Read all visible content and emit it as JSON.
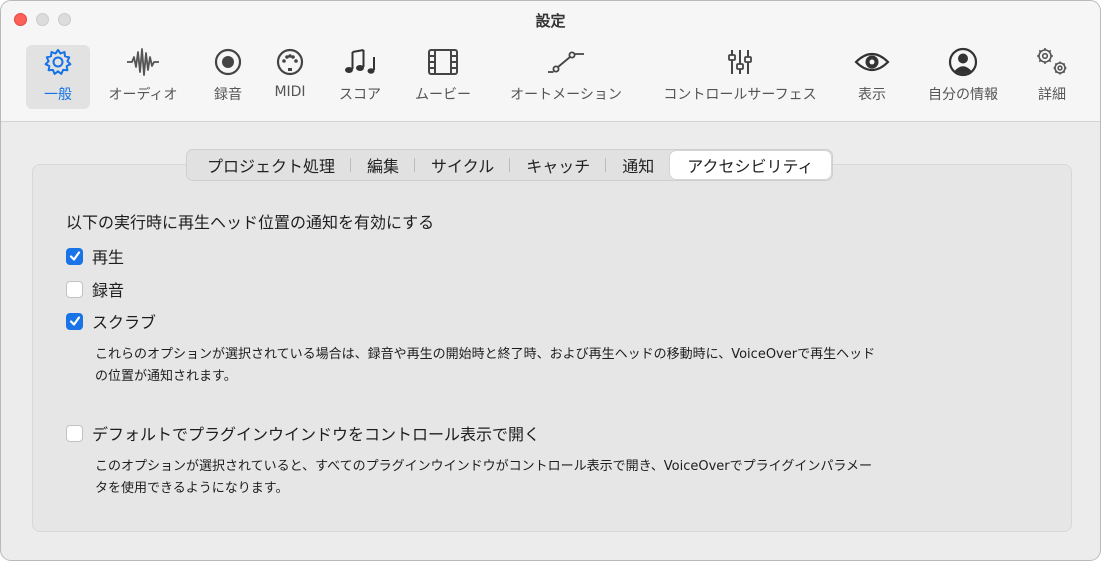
{
  "window": {
    "title": "設定"
  },
  "toolbar": {
    "items": [
      {
        "label": "一般",
        "icon": "gear-icon",
        "active": true
      },
      {
        "label": "オーディオ",
        "icon": "waveform-icon"
      },
      {
        "label": "録音",
        "icon": "record-icon"
      },
      {
        "label": "MIDI",
        "icon": "midi-port-icon"
      },
      {
        "label": "スコア",
        "icon": "music-notes-icon"
      },
      {
        "label": "ムービー",
        "icon": "film-icon"
      },
      {
        "label": "オートメーション",
        "icon": "automation-curve-icon"
      },
      {
        "label": "コントロールサーフェス",
        "icon": "sliders-icon"
      },
      {
        "label": "表示",
        "icon": "eye-icon"
      },
      {
        "label": "自分の情報",
        "icon": "person-icon"
      },
      {
        "label": "詳細",
        "icon": "gears-icon"
      }
    ]
  },
  "tabs": [
    {
      "label": "プロジェクト処理"
    },
    {
      "label": "編集"
    },
    {
      "label": "サイクル"
    },
    {
      "label": "キャッチ"
    },
    {
      "label": "通知"
    },
    {
      "label": "アクセシビリティ",
      "selected": true
    }
  ],
  "main": {
    "heading": "以下の実行時に再生ヘッド位置の通知を有効にする",
    "options": [
      {
        "label": "再生",
        "checked": true
      },
      {
        "label": "録音",
        "checked": false
      },
      {
        "label": "スクラブ",
        "checked": true
      }
    ],
    "options_desc_1": "これらのオプションが選択されている場合は、録音や再生の開始時と終了時、および再生ヘッドの移動時に、VoiceOverで再生ヘッド",
    "options_desc_2": "の位置が通知されます。",
    "plugin_option": {
      "label": "デフォルトでプラグインウインドウをコントロール表示で開く",
      "checked": false
    },
    "plugin_desc_1": "このオプションが選択されていると、すべてのプラグインウインドウがコントロール表示で開き、VoiceOverでプライグインパラメー",
    "plugin_desc_2": "タを使用できるようになります。"
  },
  "colors": {
    "accent": "#1a74e8",
    "close": "#fe5f57"
  }
}
